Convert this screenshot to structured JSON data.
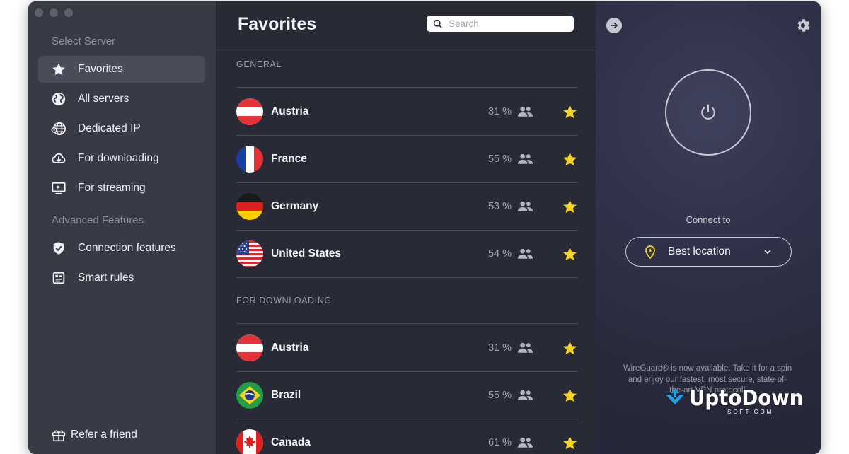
{
  "sidebar": {
    "select_server_label": "Select Server",
    "items": [
      {
        "label": "Favorites",
        "icon": "star-icon",
        "active": true
      },
      {
        "label": "All servers",
        "icon": "globe-icon"
      },
      {
        "label": "Dedicated IP",
        "icon": "dedicated-ip-globe-icon"
      },
      {
        "label": "For downloading",
        "icon": "cloud-download-icon"
      },
      {
        "label": "For streaming",
        "icon": "tv-play-icon"
      }
    ],
    "advanced_label": "Advanced Features",
    "advanced_items": [
      {
        "label": "Connection features",
        "icon": "shield-check-icon"
      },
      {
        "label": "Smart rules",
        "icon": "rules-icon"
      }
    ],
    "refer_label": "Refer a friend"
  },
  "main": {
    "title": "Favorites",
    "search_placeholder": "Search",
    "groups": [
      {
        "label": "GENERAL",
        "rows": [
          {
            "country": "Austria",
            "load": "31 %",
            "flag": "austria"
          },
          {
            "country": "France",
            "load": "55 %",
            "flag": "france"
          },
          {
            "country": "Germany",
            "load": "53 %",
            "flag": "germany"
          },
          {
            "country": "United States",
            "load": "54 %",
            "flag": "usa"
          }
        ]
      },
      {
        "label": "FOR DOWNLOADING",
        "rows": [
          {
            "country": "Austria",
            "load": "31 %",
            "flag": "austria"
          },
          {
            "country": "Brazil",
            "load": "55 %",
            "flag": "brazil"
          },
          {
            "country": "Canada",
            "load": "61 %",
            "flag": "canada"
          }
        ]
      }
    ]
  },
  "right": {
    "connect_label": "Connect to",
    "location_label": "Best location",
    "notice": "WireGuard® is now available. Take it for a spin and enjoy our fastest, most secure, state-of-the-art VPN protocol!"
  },
  "watermark": {
    "brand": "UptoDown",
    "sub": "SOFT.COM"
  },
  "colors": {
    "sidebar_bg": "#383a46",
    "main_bg": "#282a36",
    "star": "#f5d31f",
    "text": "#f2f3f7"
  }
}
